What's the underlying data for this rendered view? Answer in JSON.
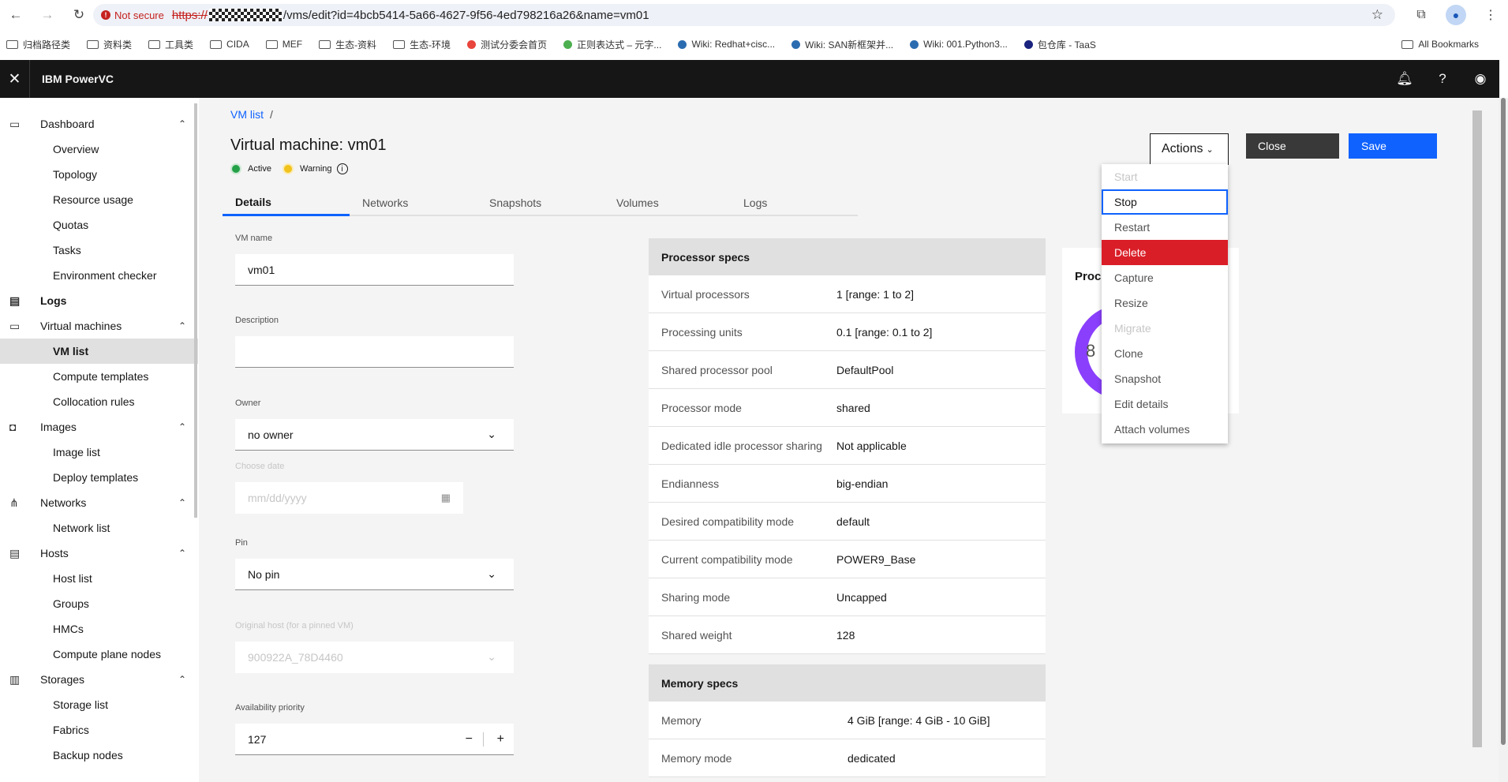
{
  "browser": {
    "not_secure": "Not secure",
    "url_scheme": "https://",
    "url_rest": "/vms/edit?id=4bcb5414-5a66-4627-9f56-4ed798216a26&name=vm01",
    "bookmarks": [
      {
        "label": "归档路径类",
        "type": "folder"
      },
      {
        "label": "资料类",
        "type": "folder"
      },
      {
        "label": "工具类",
        "type": "folder"
      },
      {
        "label": "CIDA",
        "type": "folder"
      },
      {
        "label": "MEF",
        "type": "folder"
      },
      {
        "label": "生态-资料",
        "type": "folder"
      },
      {
        "label": "生态-环境",
        "type": "folder"
      },
      {
        "label": "测试分委会首页",
        "type": "site",
        "color": "#e8453c"
      },
      {
        "label": "正则表达式 – 元字...",
        "type": "site",
        "color": "#4caf50"
      },
      {
        "label": "Wiki: Redhat+cisc...",
        "type": "site",
        "color": "#2b6cb0"
      },
      {
        "label": "Wiki: SAN新框架并...",
        "type": "site",
        "color": "#2b6cb0"
      },
      {
        "label": "Wiki: 001.Python3...",
        "type": "site",
        "color": "#2b6cb0"
      },
      {
        "label": "包仓库 - TaaS",
        "type": "site",
        "color": "#1a237e"
      }
    ],
    "all_bookmarks": "All Bookmarks"
  },
  "header": {
    "brand": "IBM PowerVC"
  },
  "sidebar": {
    "groups": [
      {
        "label": "Dashboard",
        "icon": "monitor-icon",
        "items": [
          "Overview",
          "Topology",
          "Resource usage",
          "Quotas",
          "Tasks",
          "Environment checker"
        ]
      },
      {
        "label": "Logs",
        "icon": "log-icon",
        "items": []
      },
      {
        "label": "Virtual machines",
        "icon": "vm-icon",
        "items": [
          "VM list",
          "Compute templates",
          "Collocation rules"
        ]
      },
      {
        "label": "Images",
        "icon": "camera-icon",
        "items": [
          "Image list",
          "Deploy templates"
        ]
      },
      {
        "label": "Networks",
        "icon": "network-icon",
        "items": [
          "Network list"
        ]
      },
      {
        "label": "Hosts",
        "icon": "host-icon",
        "items": [
          "Host list",
          "Groups",
          "HMCs",
          "Compute plane nodes"
        ]
      },
      {
        "label": "Storages",
        "icon": "storage-icon",
        "items": [
          "Storage list",
          "Fabrics",
          "Backup nodes"
        ]
      }
    ],
    "active_item": "VM list"
  },
  "page": {
    "breadcrumb": "VM list",
    "breadcrumb_sep": "/",
    "title": "Virtual machine: vm01",
    "status_active": "Active",
    "status_warning": "Warning",
    "tabs": [
      "Details",
      "Networks",
      "Snapshots",
      "Volumes",
      "Logs"
    ],
    "form": {
      "vm_name_label": "VM name",
      "vm_name_value": "vm01",
      "description_label": "Description",
      "description_value": "",
      "owner_label": "Owner",
      "owner_value": "no owner",
      "choose_date_label": "Choose date",
      "date_placeholder": "mm/dd/yyyy",
      "pin_label": "Pin",
      "pin_value": "No pin",
      "original_host_label": "Original host (for a pinned VM)",
      "original_host_value": "900922A_78D4460",
      "availability_label": "Availability priority",
      "availability_value": "127",
      "minus": "−",
      "plus": "+"
    },
    "processor_specs": {
      "heading": "Processor specs",
      "rows": [
        {
          "key": "Virtual processors",
          "value": "1 [range: 1 to 2]"
        },
        {
          "key": "Processing units",
          "value": "0.1 [range: 0.1 to 2]"
        },
        {
          "key": "Shared processor pool",
          "value": "DefaultPool"
        },
        {
          "key": "Processor mode",
          "value": "shared"
        },
        {
          "key": "Dedicated idle processor sharing",
          "value": "Not applicable"
        },
        {
          "key": "Endianness",
          "value": "big-endian"
        },
        {
          "key": "Desired compatibility mode",
          "value": "default"
        },
        {
          "key": "Current compatibility mode",
          "value": "POWER9_Base"
        },
        {
          "key": "Sharing mode",
          "value": "Uncapped"
        },
        {
          "key": "Shared weight",
          "value": "128"
        }
      ]
    },
    "memory_specs": {
      "heading": "Memory specs",
      "rows": [
        {
          "key": "Memory",
          "value": "4 GiB [range: 4 GiB - 10 GiB]"
        },
        {
          "key": "Memory mode",
          "value": "dedicated"
        }
      ]
    },
    "proc_card_title": "Proc",
    "proc_card_value": "8",
    "actions_label": "Actions",
    "close_label": "Close",
    "save_label": "Save",
    "actions_menu": [
      {
        "label": "Start",
        "state": "disabled"
      },
      {
        "label": "Stop",
        "state": "focused"
      },
      {
        "label": "Restart",
        "state": "normal"
      },
      {
        "label": "Delete",
        "state": "danger"
      },
      {
        "label": "Capture",
        "state": "normal"
      },
      {
        "label": "Resize",
        "state": "normal"
      },
      {
        "label": "Migrate",
        "state": "disabled"
      },
      {
        "label": "Clone",
        "state": "normal"
      },
      {
        "label": "Snapshot",
        "state": "normal"
      },
      {
        "label": "Edit details",
        "state": "normal"
      },
      {
        "label": "Attach volumes",
        "state": "normal"
      }
    ]
  },
  "colors": {
    "accent": "#0f62fe",
    "danger": "#da1e28",
    "header_bg": "#161616",
    "active_status": "#24a148",
    "warning_status": "#f1c21b",
    "donut": "#8a3ffc"
  }
}
